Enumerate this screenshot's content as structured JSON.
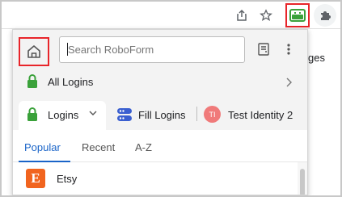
{
  "browser": {
    "background_text": "ges",
    "icons": [
      "share-icon",
      "star-icon",
      "roboform-extension-icon",
      "extensions-puzzle-icon"
    ]
  },
  "popup": {
    "search": {
      "placeholder": "Search RoboForm",
      "value": ""
    },
    "all_logins": {
      "label": "All Logins"
    },
    "tabs": {
      "logins": {
        "label": "Logins"
      },
      "fill_logins": {
        "label": "Fill Logins"
      },
      "identity": {
        "initials": "TI",
        "label": "Test Identity 2"
      }
    },
    "subtabs": [
      "Popular",
      "Recent",
      "A-Z"
    ],
    "active_subtab": "Popular",
    "items": [
      {
        "label": "Etsy",
        "icon_letter": "E",
        "icon_color": "#f1641e"
      }
    ]
  },
  "colors": {
    "highlight": "#e8252a",
    "accent_blue": "#1a64c8",
    "lock_green": "#3aa13a",
    "identity_avatar": "#f07a7a"
  }
}
